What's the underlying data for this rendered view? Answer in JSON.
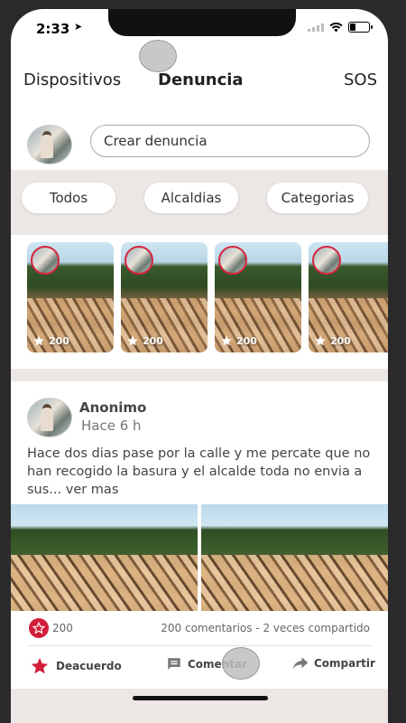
{
  "status": {
    "time": "2:33"
  },
  "nav": {
    "tabs": [
      "Dispositivos",
      "Denuncia",
      "SOS"
    ],
    "active": 1
  },
  "create": {
    "placeholder": "Crear denuncia"
  },
  "filters": [
    "Todos",
    "Alcaldias",
    "Categorias"
  ],
  "stories": [
    {
      "count": "200"
    },
    {
      "count": "200"
    },
    {
      "count": "200"
    },
    {
      "count": "200"
    }
  ],
  "post": {
    "author": "Anonimo",
    "time": "Hace 6 h",
    "text": "Hace dos dias pase por la calle y me percate que no han recogido la basura y el alcalde toda no envia a sus... ver mas",
    "likes": "200",
    "comments_shares": "200 comentarios - 2 veces compartido",
    "actions": {
      "agree": "Deacuerdo",
      "comment": "Comentar",
      "share": "Compartir"
    }
  },
  "colors": {
    "accent": "#d21e3b",
    "band": "#ece7e4"
  },
  "icons": [
    "star-icon",
    "comment-icon",
    "share-icon",
    "wifi-icon",
    "battery-icon",
    "location-arrow-icon"
  ]
}
